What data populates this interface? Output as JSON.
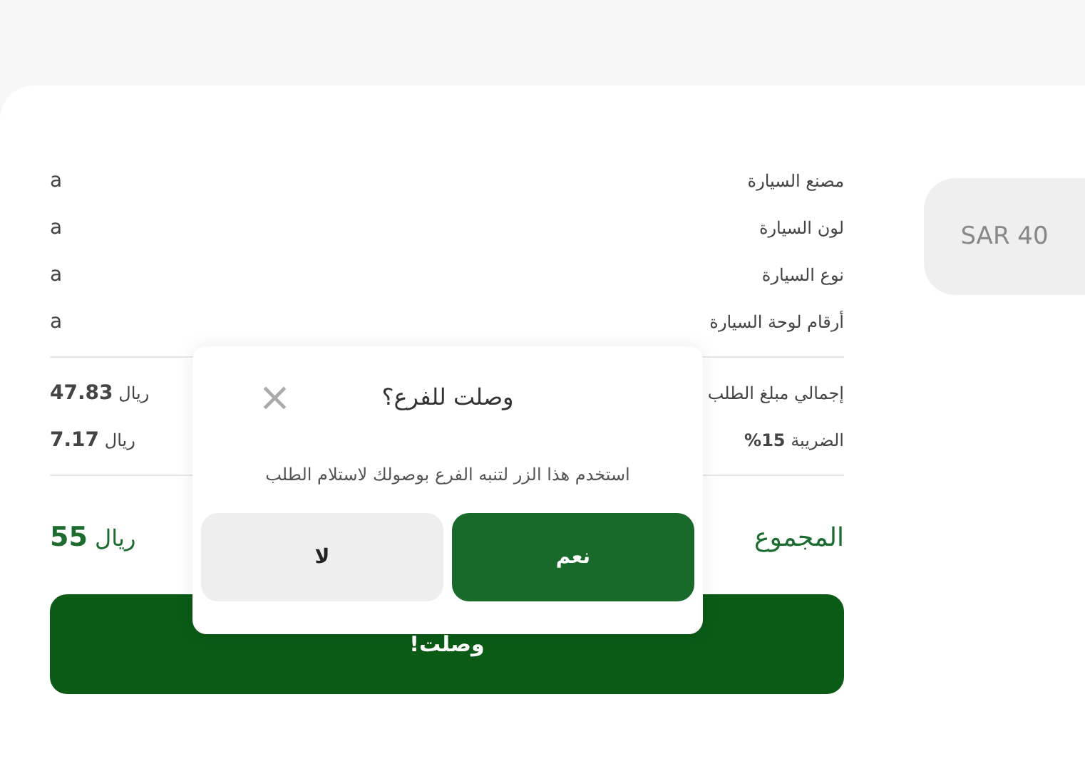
{
  "details": [
    {
      "label": "مصنع السيارة",
      "value": "a"
    },
    {
      "label": "لون السيارة",
      "value": "a"
    },
    {
      "label": "نوع السيارة",
      "value": "a"
    },
    {
      "label": "أرقام لوحة السيارة",
      "value": "a"
    }
  ],
  "amounts": [
    {
      "label": "إجمالي مبلغ الطلب",
      "value": "**47.83** ريال"
    },
    {
      "label": "الضريبة **15%**",
      "value": "**7.17** ريال"
    }
  ],
  "total": {
    "label": "المجموع",
    "value": "**55** ريال"
  },
  "arrived_button": "وصلت!",
  "price_chip": "SAR 40",
  "dialog": {
    "title": "وصلت للفرع؟",
    "close": "×",
    "message": "استخدم هذا الزر لتنبه الفرع بوصولك لاستلام الطلب",
    "buttons": [
      {
        "label": "نعم",
        "kind": "primary"
      },
      {
        "label": "لا",
        "kind": "secondary"
      }
    ]
  }
}
